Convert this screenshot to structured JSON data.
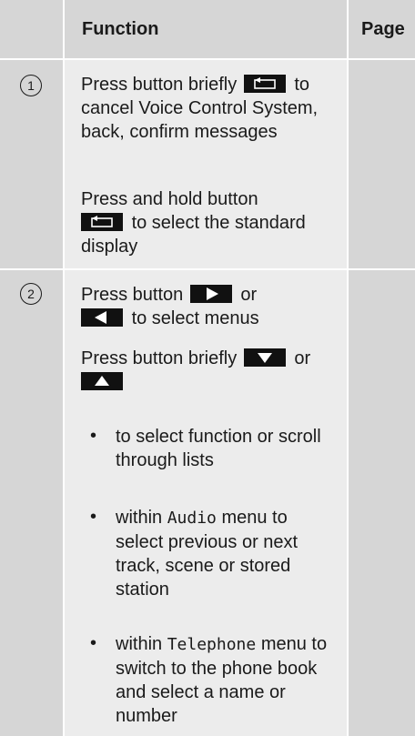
{
  "header": {
    "function": "Function",
    "page": "Page"
  },
  "rows": [
    {
      "number": "1",
      "p1_a": "Press button briefly",
      "p1_b": "to cancel Voice Control System, back, confirm messages",
      "p2_a": "Press and hold button",
      "p2_b": "to select the standard display",
      "button_icon": "back-icon"
    },
    {
      "number": "2",
      "p1_a": "Press button",
      "p1_b": "or",
      "p1_c": "to select menus",
      "p2_a": "Press button briefly",
      "p2_b": "or",
      "bullets": [
        {
          "bullet": "•",
          "text": "to select function or scroll through lists"
        },
        {
          "bullet": "•",
          "pre": "within",
          "mono": "Audio",
          "post": "menu to select previous or next track, scene or stored station"
        },
        {
          "bullet": "•",
          "pre": "within",
          "mono": "Telephone",
          "post": "menu to switch to the phone book and select a name or number"
        }
      ]
    }
  ]
}
